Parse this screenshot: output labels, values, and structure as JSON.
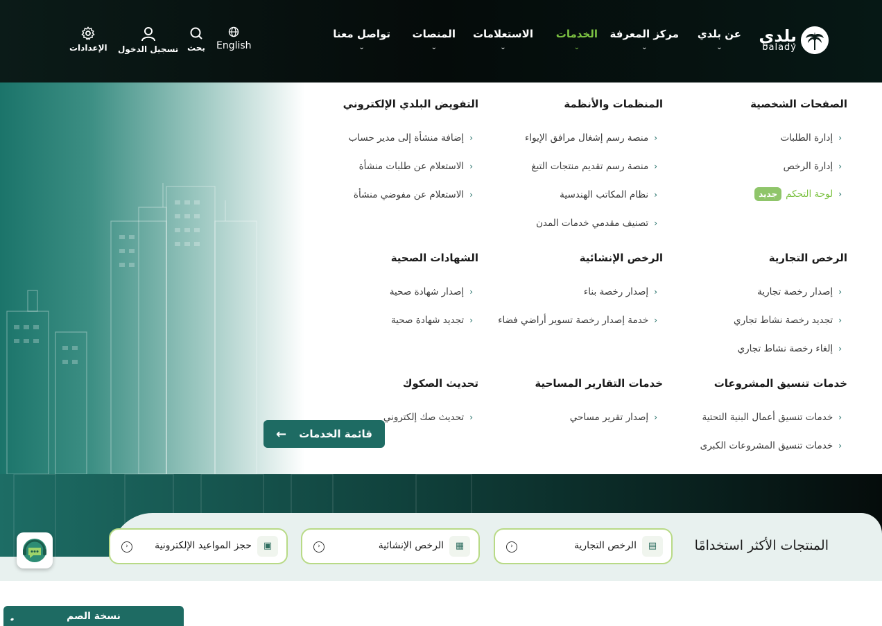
{
  "header": {
    "logo": {
      "ar": "بلدي",
      "en": "balady"
    },
    "nav": [
      {
        "label": "عن بلدي"
      },
      {
        "label": "مركز المعرفة"
      },
      {
        "label": "الخدمات",
        "active": true
      },
      {
        "label": "الاستعلامات"
      },
      {
        "label": "المنصات"
      },
      {
        "label": "تواصل معنا"
      }
    ],
    "tools": {
      "language": "English",
      "search": "بحث",
      "login": "تسجيل الدخول",
      "settings": "الإعدادات"
    },
    "colors": {
      "active": "#7cc242",
      "background": "#050b0a"
    }
  },
  "mega": {
    "columns": [
      {
        "title": "الصفحات الشخصية",
        "items": [
          "إدارة الطلبات",
          "إدارة الرخص",
          "لوحة التحكم"
        ],
        "badge": "جديد"
      },
      {
        "title": "المنظمات والأنظمة",
        "items": [
          "منصة رسم إشغال مرافق الإيواء",
          "منصة رسم تقديم منتجات التبغ",
          "نظام المكاتب الهندسية",
          "تصنيف مقدمي خدمات المدن"
        ]
      },
      {
        "title": "التفويض البلدي الإلكتروني",
        "items": [
          "إضافة منشأة إلى مدير حساب",
          "الاستعلام عن طلبات منشأة",
          "الاستعلام عن مفوضي منشأة"
        ]
      },
      {
        "title": "الرخص التجارية",
        "items": [
          "إصدار رخصة تجارية",
          "تجديد رخصة نشاط تجاري",
          "إلغاء رخصة نشاط تجاري"
        ]
      },
      {
        "title": "الرخص الإنشائية",
        "items": [
          "إصدار رخصة بناء",
          "خدمة إصدار رخصة تسوير أراضي فضاء"
        ]
      },
      {
        "title": "الشهادات الصحية",
        "items": [
          "إصدار شهادة صحية",
          "تجديد شهادة صحية"
        ]
      },
      {
        "title": "خدمات تنسيق المشروعات",
        "items": [
          "خدمات تنسيق أعمال البنية التحتية",
          "خدمات تنسيق المشروعات الكبرى"
        ]
      },
      {
        "title": "خدمات التقارير المساحية",
        "items": [
          "إصدار تقرير مساحي"
        ]
      },
      {
        "title": "تحديث الصكوك",
        "items": [
          "تحديث صك إلكتروني"
        ]
      }
    ],
    "services_button": "قائمة الخدمات"
  },
  "products": {
    "title": "المنتجات الأكثر استخدامًا",
    "cards": [
      {
        "label": "الرخص التجارية",
        "icon": "commercial-license-icon"
      },
      {
        "label": "الرخص الإنشائية",
        "icon": "building-license-icon"
      },
      {
        "label": "حجز المواعيد الإلكترونية",
        "icon": "appointment-icon"
      }
    ]
  },
  "footer": {
    "deaf_version": "نسخة الصم"
  }
}
